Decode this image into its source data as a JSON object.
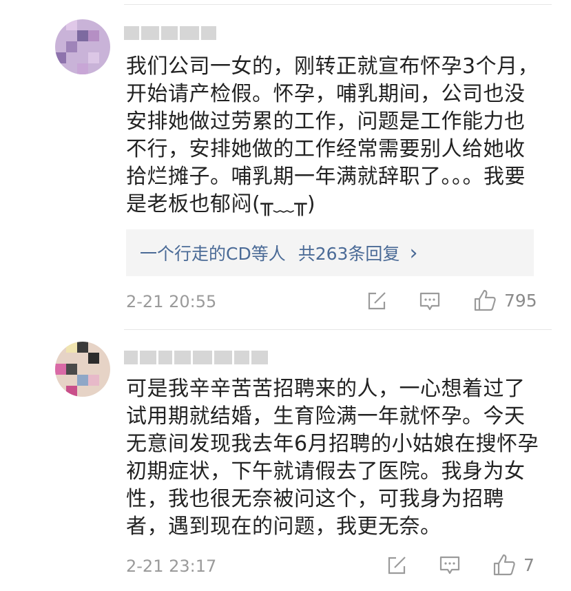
{
  "comments": [
    {
      "body": "我们公司一女的，刚转正就宣布怀孕3个月，开始请产检假。怀孕，哺乳期间，公司也没安排她做过劳累的工作，问题是工作能力也不行，安排她做的工作经常需要别人给她收拾烂摊子。哺乳期一年满就辞职了。。。我要是老板也郁闷(╥﹏╥)",
      "replies": {
        "names": "一个行走的CD等人",
        "count_text": "共263条回复",
        "chevron": "›"
      },
      "timestamp": "2-21 20:55",
      "likes": "795",
      "icons": [
        "share-icon",
        "reply-icon",
        "like-icon"
      ]
    },
    {
      "body": "可是我辛辛苦苦招聘来的人，一心想着过了试用期就结婚，生育险满一年就怀孕。今天无意间发现我去年6月招聘的小姑娘在搜怀孕初期症状，下午就请假去了医院。我身为女性，我也很无奈被问这个，可我身为招聘者，遇到现在的问题，我更无奈。",
      "timestamp": "2-21 23:17",
      "likes": "7",
      "icons": [
        "share-icon",
        "reply-icon",
        "like-icon"
      ]
    }
  ],
  "colors": {
    "link": "#4a6a96",
    "meta": "#9a9a9a",
    "reply_bg": "#f4f4f4"
  }
}
